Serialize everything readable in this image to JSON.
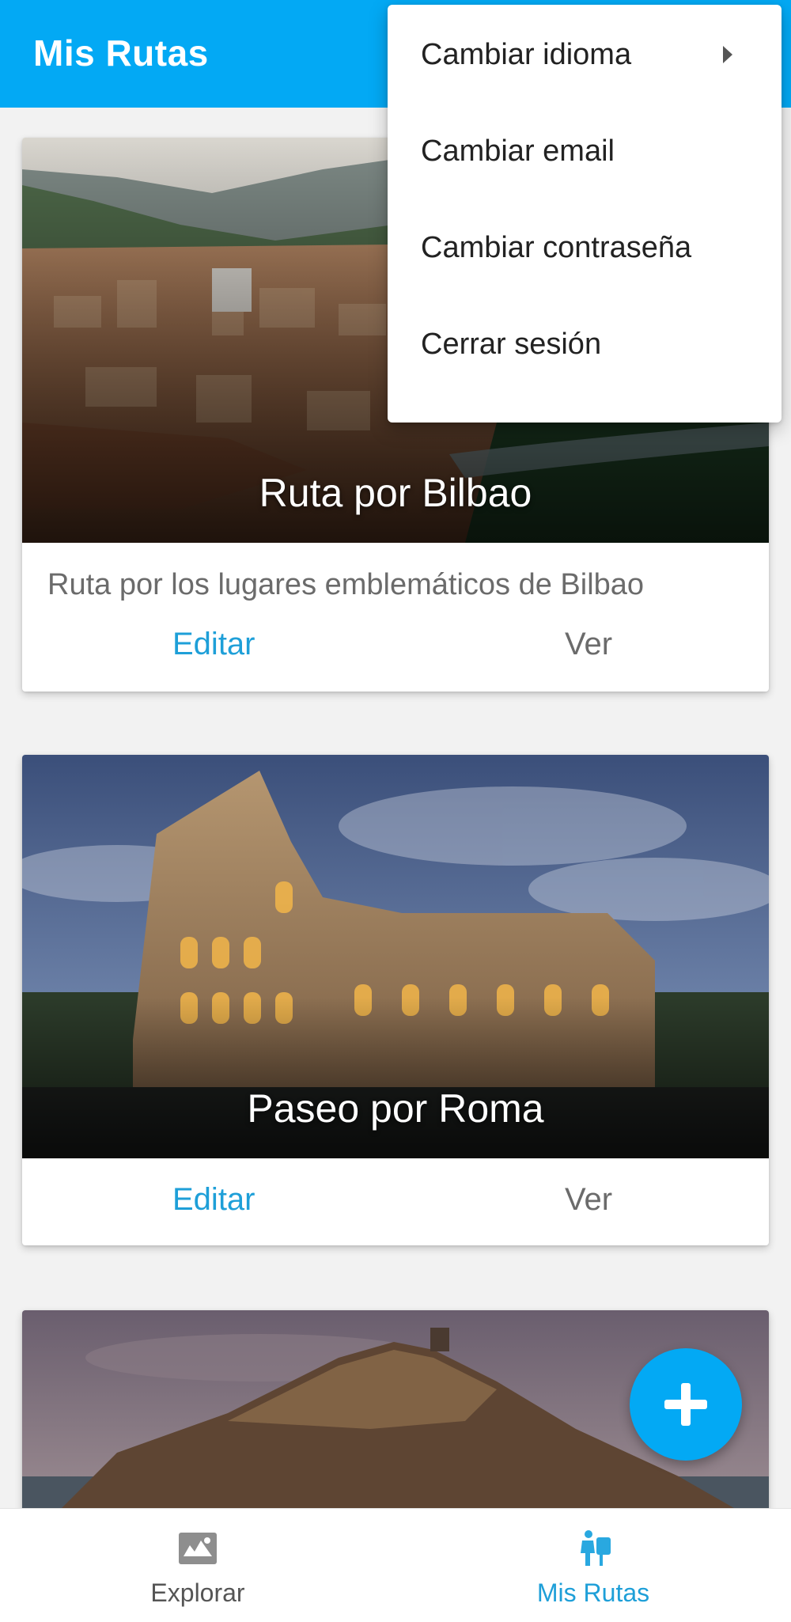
{
  "app_bar": {
    "title": "Mis Rutas"
  },
  "overflow_menu": {
    "items": [
      {
        "label": "Cambiar idioma",
        "has_submenu": true
      },
      {
        "label": "Cambiar email",
        "has_submenu": false
      },
      {
        "label": "Cambiar contraseña",
        "has_submenu": false
      },
      {
        "label": "Cerrar sesión",
        "has_submenu": false
      }
    ]
  },
  "routes": [
    {
      "title": "Ruta por Bilbao",
      "description": "Ruta por los lugares emblemáticos de Bilbao",
      "edit_label": "Editar",
      "view_label": "Ver"
    },
    {
      "title": "Paseo por Roma",
      "description": "",
      "edit_label": "Editar",
      "view_label": "Ver"
    },
    {
      "title": "",
      "description": "",
      "edit_label": "",
      "view_label": ""
    }
  ],
  "fab": {
    "icon": "plus-icon"
  },
  "bottom_nav": {
    "items": [
      {
        "label": "Explorar",
        "icon": "explore-map-icon",
        "active": false
      },
      {
        "label": "Mis Rutas",
        "icon": "hiker-icon",
        "active": true
      }
    ]
  },
  "colors": {
    "primary": "#03A9F4",
    "action_edit": "#1E9FD8",
    "inactive": "#6b6b6b"
  }
}
